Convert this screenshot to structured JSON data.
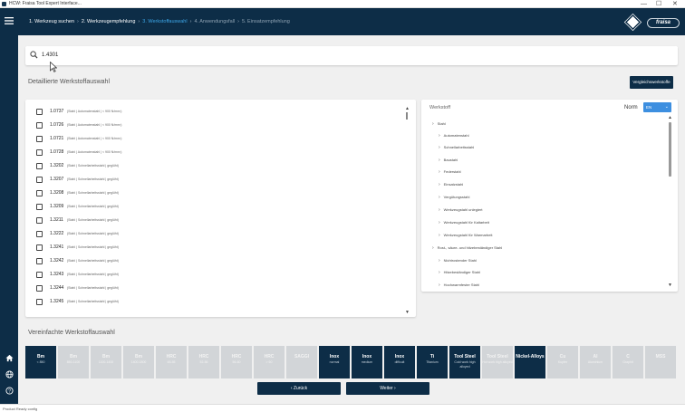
{
  "window": {
    "title": "HCW: Fraisa Tool Expert Interface...",
    "minimize": "—",
    "maximize": "☐",
    "close": "✕"
  },
  "steps": [
    {
      "label": "1. Werkzeug suchen",
      "state": "done"
    },
    {
      "label": "2. Werkzeugempfehlung",
      "state": "done"
    },
    {
      "label": "3. Werkstoffauswahl",
      "state": "active"
    },
    {
      "label": "4. Anwendungsfall",
      "state": "future"
    },
    {
      "label": "5. Einsatzempfehlung",
      "state": "future"
    }
  ],
  "brand": "fraisa",
  "search": {
    "value": "1.4301",
    "icon": "search-icon"
  },
  "detail_section": {
    "title": "Detaillierte Werkstoffauswahl",
    "compare_button": "Vergleichswerkstoffe"
  },
  "materials": [
    {
      "num": "1.0737",
      "desc": "(Stahl | Automatenstahl | < 900 N/mm²)"
    },
    {
      "num": "1.0726",
      "desc": "(Stahl | Automatenstahl | < 900 N/mm²)"
    },
    {
      "num": "1.0721",
      "desc": "(Stahl | Automatenstahl | < 900 N/mm²)"
    },
    {
      "num": "1.0728",
      "desc": "(Stahl | Automatenstahl | < 900 N/mm²)"
    },
    {
      "num": "1.3202",
      "desc": "(Stahl | Schnellarbeitsstahl | geglüht)"
    },
    {
      "num": "1.3207",
      "desc": "(Stahl | Schnellarbeitsstahl | geglüht)"
    },
    {
      "num": "1.3208",
      "desc": "(Stahl | Schnellarbeitsstahl | geglüht)"
    },
    {
      "num": "1.3209",
      "desc": "(Stahl | Schnellarbeitsstahl | geglüht)"
    },
    {
      "num": "1.3211",
      "desc": "(Stahl | Schnellarbeitsstahl | geglüht)"
    },
    {
      "num": "1.3222",
      "desc": "(Stahl | Schnellarbeitsstahl | geglüht)"
    },
    {
      "num": "1.3241",
      "desc": "(Stahl | Schnellarbeitsstahl | geglüht)"
    },
    {
      "num": "1.3242",
      "desc": "(Stahl | Schnellarbeitsstahl | geglüht)"
    },
    {
      "num": "1.3243",
      "desc": "(Stahl | Schnellarbeitsstahl | geglüht)"
    },
    {
      "num": "1.3244",
      "desc": "(Stahl | Schnellarbeitsstahl | geglüht)"
    },
    {
      "num": "1.3245",
      "desc": "(Stahl | Schnellarbeitsstahl | geglüht)"
    }
  ],
  "tree": {
    "header": "Werkstoff",
    "norm_label": "Norm",
    "norm_value": "EN",
    "items": [
      {
        "label": "Stahl",
        "level": 0
      },
      {
        "label": "Automatenstahl",
        "level": 1
      },
      {
        "label": "Schnellarbeitsstahl",
        "level": 1
      },
      {
        "label": "Baustahl",
        "level": 1
      },
      {
        "label": "Federstahl",
        "level": 1
      },
      {
        "label": "Einsatzstahl",
        "level": 1
      },
      {
        "label": "Vergütungsstahl",
        "level": 1
      },
      {
        "label": "Werkzeugstahl unlegiert",
        "level": 1
      },
      {
        "label": "Werkzeugstahl für Kaltarbeit",
        "level": 1
      },
      {
        "label": "Werkzeugstahl für Warmarbeit",
        "level": 1
      },
      {
        "label": "Rost-, säure- und hitzebeständiger Stahl",
        "level": 0
      },
      {
        "label": "Nichtrostender Stahl",
        "level": 1
      },
      {
        "label": "Hitzebeständiger Stahl",
        "level": 1
      },
      {
        "label": "Hochwarmfester Stahl",
        "level": 1
      }
    ]
  },
  "simple_section": {
    "title": "Vereinfachte Werkstoffauswahl"
  },
  "tiles": [
    {
      "t1": "Bm",
      "t2": "< 850",
      "selected": true
    },
    {
      "t1": "Bm",
      "t2": "850-1100",
      "selected": false
    },
    {
      "t1": "Bm",
      "t2": "1100-1400",
      "selected": false
    },
    {
      "t1": "Bm",
      "t2": "1400-1800",
      "selected": false
    },
    {
      "t1": "HRC",
      "t2": "48-55",
      "selected": false
    },
    {
      "t1": "HRC",
      "t2": "52-56",
      "selected": false
    },
    {
      "t1": "HRC",
      "t2": "56-60",
      "selected": false
    },
    {
      "t1": "HRC",
      "t2": "> 60",
      "selected": false
    },
    {
      "t1": "SAGGI",
      "t2": "",
      "selected": false
    },
    {
      "t1": "Inox",
      "t2": "normal",
      "selected": true
    },
    {
      "t1": "Inox",
      "t2": "medium",
      "selected": true
    },
    {
      "t1": "Inox",
      "t2": "difficult",
      "selected": true
    },
    {
      "t1": "Ti",
      "t2": "Titanium",
      "selected": true
    },
    {
      "t1": "Tool Steel",
      "t2": "Cold work high alloyed",
      "selected": true
    },
    {
      "t1": "Tool Steel",
      "t2": "Hot work high alloyed",
      "selected": false
    },
    {
      "t1": "Nickel-Alloys",
      "t2": "",
      "selected": true
    },
    {
      "t1": "Cu",
      "t2": "Kupfer",
      "selected": false
    },
    {
      "t1": "Al",
      "t2": "Aluminium",
      "selected": false
    },
    {
      "t1": "C",
      "t2": "Graphit",
      "selected": false
    },
    {
      "t1": "MSS",
      "t2": "",
      "selected": false
    }
  ],
  "nav": {
    "back": "Zurück",
    "next": "Weiter"
  },
  "status": "Product Ready config"
}
